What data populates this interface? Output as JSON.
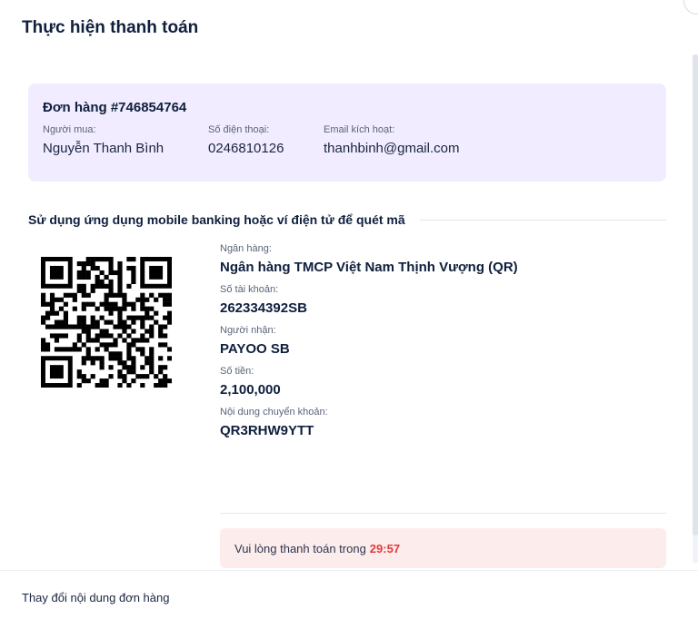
{
  "modal": {
    "title": "Thực hiện thanh toán"
  },
  "order": {
    "id": "Đơn hàng #746854764",
    "buyer_label": "Người mua:",
    "buyer_value": "Nguyễn Thanh Bình",
    "phone_label": "Số điện thoại:",
    "phone_value": "0246810126",
    "email_label": "Email kích hoạt:",
    "email_value": "thanhbinh@gmail.com"
  },
  "payment": {
    "instruction": "Sử dụng ứng dụng mobile banking hoặc ví điện tử để quét mã",
    "qr_icon": "qr-code-icon",
    "bank_label": "Ngân hàng:",
    "bank_value": "Ngân hàng TMCP Việt Nam Thịnh Vượng (QR)",
    "account_label": "Số tài khoản:",
    "account_value": "262334392SB",
    "recipient_label": "Người nhận:",
    "recipient_value": "PAYOO SB",
    "amount_label": "Số tiền:",
    "amount_value": "2,100,000",
    "content_label": "Nội dung chuyển khoản:",
    "content_value": "QR3RHW9YTT"
  },
  "timer": {
    "text": "Vui lòng thanh toán trong",
    "time": "29:57",
    "time_color": "#e03a3a"
  },
  "footer": {
    "change_link": "Thay đổi nội dung đơn hàng"
  },
  "colors": {
    "order_card_bg": "#f1ecff",
    "timer_bg": "#fdecec",
    "heading": "#0f1f3d"
  }
}
